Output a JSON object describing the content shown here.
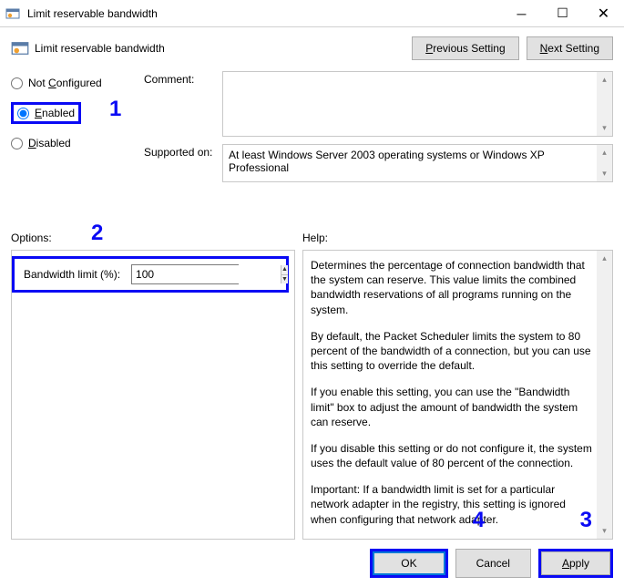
{
  "window": {
    "title": "Limit reservable bandwidth",
    "subtitle": "Limit reservable bandwidth"
  },
  "nav": {
    "previous": "Previous Setting",
    "next": "Next Setting"
  },
  "radios": {
    "not_configured": "Not Configured",
    "enabled": "Enabled",
    "disabled": "Disabled"
  },
  "labels": {
    "comment": "Comment:",
    "supported_on": "Supported on:",
    "options": "Options:",
    "help": "Help:",
    "bandwidth_limit": "Bandwidth limit (%):"
  },
  "values": {
    "supported_on": "At least Windows Server 2003 operating systems or Windows XP Professional",
    "bandwidth_value": "100"
  },
  "help_text": {
    "p1": "Determines the percentage of connection bandwidth that the system can reserve. This value limits the combined bandwidth reservations of all programs running on the system.",
    "p2": "By default, the Packet Scheduler limits the system to 80 percent of the bandwidth of a connection, but you can use this setting to override the default.",
    "p3": "If you enable this setting, you can use the \"Bandwidth limit\" box to adjust the amount of bandwidth the system can reserve.",
    "p4": "If you disable this setting or do not configure it, the system uses the default value of 80 percent of the connection.",
    "p5": "Important: If a bandwidth limit is set for a particular network adapter in the registry, this setting is ignored when configuring that network adapter."
  },
  "buttons": {
    "ok": "OK",
    "cancel": "Cancel",
    "apply": "Apply"
  },
  "annotations": {
    "a1": "1",
    "a2": "2",
    "a3": "3",
    "a4": "4"
  }
}
